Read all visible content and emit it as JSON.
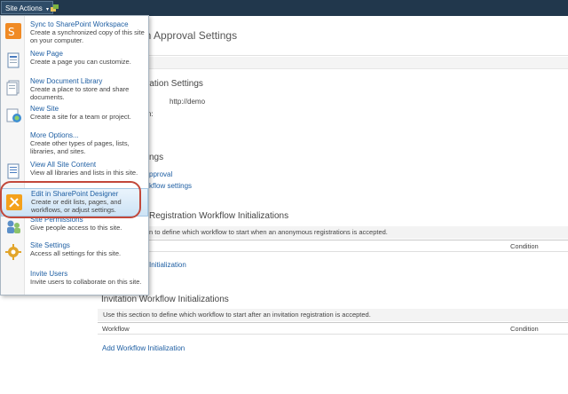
{
  "topbar": {
    "site_actions_label": "Site Actions",
    "caret": "▾"
  },
  "page": {
    "title": "on Approval Settings",
    "section1": {
      "heading": "istration Settings",
      "field_prefix": "n:",
      "url": "http://demo"
    },
    "section2": {
      "heading": "ngs",
      "link1": "pproval",
      "link2": "kflow settings"
    },
    "section3": {
      "heading": "Registration Workflow Initializations",
      "description": "n to define which workflow to start when an anonymous registrations is accepted.",
      "col_condition": "Condition",
      "add_link": "Initialization"
    },
    "section4": {
      "heading": "Invitation Workflow Initializations",
      "description": "Use this section to define which workflow to start after an invitation registration is accepted.",
      "col_workflow": "Workflow",
      "col_condition": "Condition",
      "add_link": "Add Workflow Initialization"
    }
  },
  "menu": {
    "items": [
      {
        "title": "Sync to SharePoint Workspace",
        "desc": "Create a synchronized copy of this site on your computer.",
        "icon": "sharepoint-workspace-icon"
      },
      {
        "title": "New Page",
        "desc": "Create a page you can customize.",
        "icon": "new-page-icon"
      },
      {
        "title": "New Document Library",
        "desc": "Create a place to store and share documents.",
        "icon": "document-library-icon"
      },
      {
        "title": "New Site",
        "desc": "Create a site for a team or project.",
        "icon": "new-site-icon"
      },
      {
        "title": "More Options...",
        "desc": "Create other types of pages, lists, libraries, and sites.",
        "icon": ""
      },
      {
        "title": "View All Site Content",
        "desc": "View all libraries and lists in this site.",
        "icon": "site-content-icon"
      },
      {
        "title": "Edit in SharePoint Designer",
        "desc": "Create or edit lists, pages, and workflows, or adjust settings.",
        "icon": "sharepoint-designer-icon"
      },
      {
        "title": "Site Permissions",
        "desc": "Give people access to this site.",
        "icon": "permissions-icon"
      },
      {
        "title": "Site Settings",
        "desc": "Access all settings for this site.",
        "icon": "settings-gear-icon"
      },
      {
        "title": "Invite Users",
        "desc": "Invite users to collaborate on this site.",
        "icon": ""
      }
    ]
  },
  "colors": {
    "topbar": "#21374c",
    "link": "#1f5fa3",
    "highlight_ring": "#c2483a"
  }
}
